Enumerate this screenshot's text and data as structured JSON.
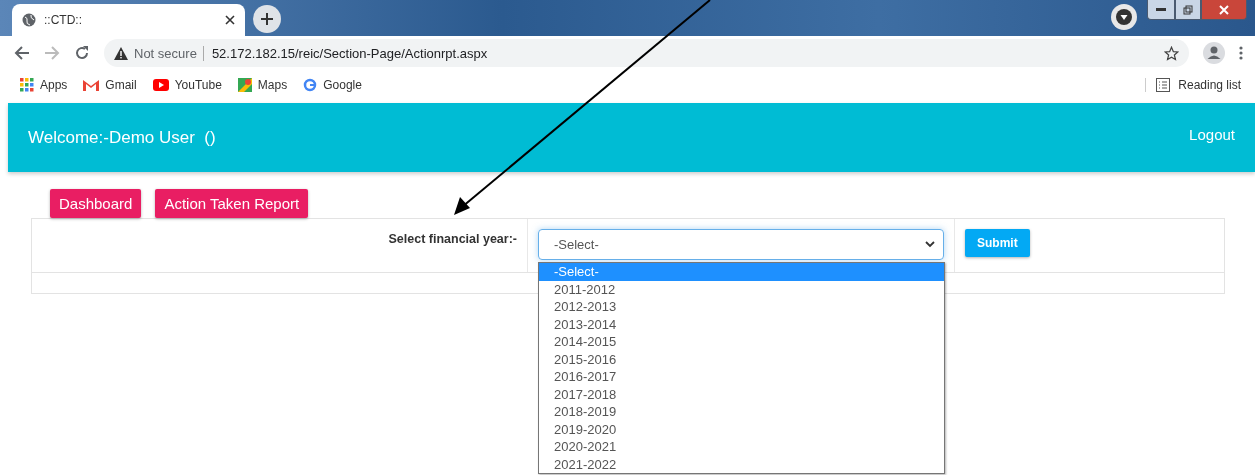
{
  "browser": {
    "tab": {
      "title": "::CTD::"
    },
    "address": {
      "warning": "Not secure",
      "url": "52.172.182.15/reic/Section-Page/Actionrpt.aspx"
    },
    "bookmarks": [
      {
        "label": "Apps"
      },
      {
        "label": "Gmail"
      },
      {
        "label": "YouTube"
      },
      {
        "label": "Maps"
      },
      {
        "label": "Google"
      }
    ],
    "reading_list": "Reading list"
  },
  "header": {
    "welcome": "Welcome:-Demo User  ()",
    "logout": "Logout"
  },
  "nav_buttons": [
    "Dashboard",
    "Action Taken Report"
  ],
  "form": {
    "label": "Select financial year:-",
    "select": {
      "value": "-Select-",
      "expanded": true,
      "options": [
        {
          "label": "-Select-",
          "selected": true
        },
        {
          "label": "2011-2012",
          "selected": false
        },
        {
          "label": "2012-2013",
          "selected": false
        },
        {
          "label": "2013-2014",
          "selected": false
        },
        {
          "label": "2014-2015",
          "selected": false
        },
        {
          "label": "2015-2016",
          "selected": false
        },
        {
          "label": "2016-2017",
          "selected": false
        },
        {
          "label": "2017-2018",
          "selected": false
        },
        {
          "label": "2018-2019",
          "selected": false
        },
        {
          "label": "2019-2020",
          "selected": false
        },
        {
          "label": "2020-2021",
          "selected": false
        },
        {
          "label": "2021-2022",
          "selected": false
        }
      ]
    },
    "submit": "Submit"
  }
}
